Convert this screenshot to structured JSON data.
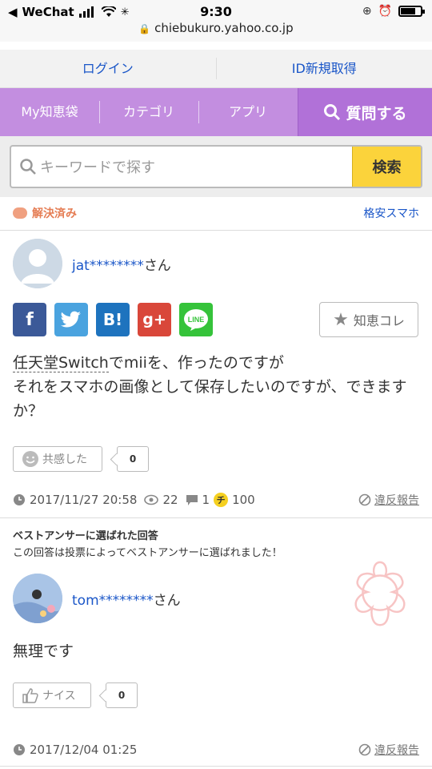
{
  "status_bar": {
    "carrier": "WeChat",
    "time": "9:30",
    "url": "chiebukuro.yahoo.co.jp"
  },
  "auth": {
    "login": "ログイン",
    "register": "ID新規取得"
  },
  "nav": {
    "my": "My知恵袋",
    "category": "カテゴリ",
    "app": "アプリ",
    "ask": "質問する"
  },
  "search": {
    "placeholder": "キーワードで探す",
    "button": "検索"
  },
  "question": {
    "status": "解決済み",
    "category": "格安スマホ",
    "user": "jat********",
    "honorific": "さん",
    "chiebukuro_button": "知恵コレ",
    "text_part1": "任天堂Switch",
    "text_part2": "でmiiを、作ったのですが",
    "text_line2": "それをスマホの画像として保存したいのですが、できますか？",
    "empathy_label": "共感した",
    "empathy_count": "0",
    "date": "2017/11/27 20:58",
    "views": "22",
    "answers": "1",
    "coin_label": "チ",
    "coins": "100",
    "report": "違反報告"
  },
  "best_answer": {
    "title": "ベストアンサーに選ばれた回答",
    "subtitle": "この回答は投票によってベストアンサーに選ばれました！",
    "user": "tom********",
    "honorific": "さん",
    "text": "無理です",
    "nice_label": "ナイス",
    "nice_count": "0",
    "date": "2017/12/04 01:25",
    "report": "違反報告"
  },
  "colors": {
    "nav": "#c38ee0",
    "ask": "#b171d8",
    "search_button": "#fbd33b",
    "link": "#1a56c8"
  }
}
